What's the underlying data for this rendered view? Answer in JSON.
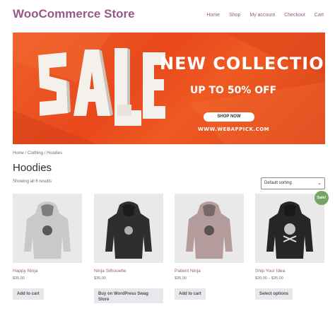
{
  "header": {
    "site_title": "WooCommerce Store",
    "nav": [
      "Home",
      "Shop",
      "My account",
      "Checkout",
      "Cart"
    ]
  },
  "banner": {
    "sale_text": "SALE",
    "headline": "NEW COLLECTION",
    "subheadline": "UP TO 50% OFF",
    "button": "SHOP NOW",
    "url": "WWW.WEBAPPICK.COM"
  },
  "breadcrumb": {
    "home": "Home",
    "category": "Clothing",
    "current": "Hoodies",
    "separator": " / "
  },
  "page": {
    "title": "Hoodies",
    "result_count": "Showing all 6 results",
    "sort_selected": "Default sorting"
  },
  "products": [
    {
      "name": "Happy Ninja",
      "price": "$35.00",
      "button": "Add to cart",
      "hoodie_color": "#c9c9c9",
      "badge": ""
    },
    {
      "name": "Ninja Silhouette",
      "price": "$35.00",
      "button": "Buy on WordPress Swag Store",
      "hoodie_color": "#2e2e2e",
      "badge": ""
    },
    {
      "name": "Patient Ninja",
      "price": "$35.00",
      "button": "Add to cart",
      "hoodie_color": "#b59c9c",
      "badge": ""
    },
    {
      "name": "Ship Your Idea",
      "price": "$30.00 – $35.00",
      "button": "Select options",
      "hoodie_color": "#262626",
      "badge": "Sale!"
    }
  ],
  "colors": {
    "brand": "#96588a",
    "banner": "#ea4f1f",
    "sale_badge": "#77a464",
    "button_bg": "#e9e6ed"
  }
}
